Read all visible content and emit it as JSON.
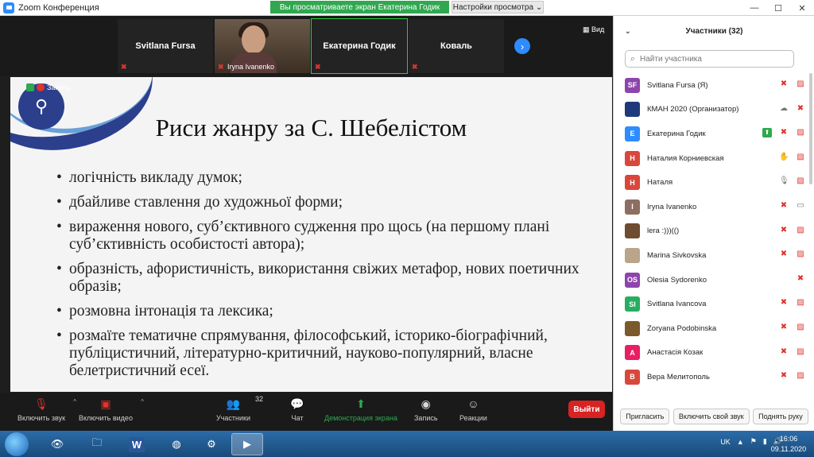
{
  "window": {
    "title": "Zoom Конференция",
    "share_banner": "Вы просматриваете экран Екатерина Годик",
    "view_options": "Настройки просмотра",
    "view_label": "Вид"
  },
  "videos": [
    {
      "name": "Svitlana Fursa"
    },
    {
      "name": "Iryna Ivanenko"
    },
    {
      "name": "Екатерина Годик"
    },
    {
      "name": "Коваль"
    }
  ],
  "slide": {
    "record_label": "Запись",
    "title": "Риси жанру за С. Шебелістом",
    "bullets": [
      "логічність викладу думок;",
      "дбайливе ставлення до художньої форми;",
      "вираження нового, суб’єктивного судження про щось (на першому плані суб’єктивність особистості автора);",
      "образність, афористичність, використання свіжих метафор, нових поетичних образів;",
      "розмовна інтонація та лексика;",
      "розмаїте тематичне спрямування, філософський, історико-біографічний, публіцистичний, літературно-критичний, науково-популярний, власне белетристичний есеї."
    ]
  },
  "toolbar": {
    "mute": "Включить звук",
    "video": "Включить видео",
    "participants": "Участники",
    "participants_count": "32",
    "chat": "Чат",
    "share": "Демонстрация экрана",
    "record": "Запись",
    "reactions": "Реакции",
    "leave": "Выйти"
  },
  "panel": {
    "header": "Участники (32)",
    "search_placeholder": "Найти участника",
    "participants": [
      {
        "initials": "SF",
        "name": "Svitlana Fursa (Я)",
        "color": "#8e44ad",
        "icons": [
          "mic-off",
          "video-off"
        ]
      },
      {
        "initials": "",
        "name": "КМАН 2020 (Организатор)",
        "color": "#1f3a7a",
        "icons": [
          "cloud",
          "mic-off"
        ]
      },
      {
        "initials": "Е",
        "name": "Екатерина Годик",
        "color": "#2d8cff",
        "icons": [
          "share",
          "mic-off",
          "video-off"
        ]
      },
      {
        "initials": "Н",
        "name": "Наталия Корниевская",
        "color": "#d9473b",
        "icons": [
          "hand",
          "video-off"
        ]
      },
      {
        "initials": "Н",
        "name": "Наталя",
        "color": "#d9473b",
        "icons": [
          "mic",
          "video-off"
        ]
      },
      {
        "initials": "I",
        "name": "Iryna Ivanenko",
        "color": "#8d6e63",
        "icons": [
          "mic-off",
          "video"
        ]
      },
      {
        "initials": "",
        "name": "lera :)))(()",
        "color": "#6d4c2f",
        "icons": [
          "mic-off",
          "video-off"
        ]
      },
      {
        "initials": "",
        "name": "Marina Sivkovska",
        "color": "#b9a58a",
        "icons": [
          "mic-off",
          "video-off"
        ]
      },
      {
        "initials": "OS",
        "name": "Olesia Sydorenko",
        "color": "#8e44ad",
        "icons": [
          "mic-off"
        ]
      },
      {
        "initials": "SI",
        "name": "Svitlana Ivancova",
        "color": "#27ae60",
        "icons": [
          "mic-off",
          "video-off"
        ]
      },
      {
        "initials": "",
        "name": "Zoryana Podobinska",
        "color": "#7a5a2a",
        "icons": [
          "mic-off",
          "video-off"
        ]
      },
      {
        "initials": "А",
        "name": "Анастасія Козак",
        "color": "#e91e63",
        "icons": [
          "mic-off",
          "video-off"
        ]
      },
      {
        "initials": "В",
        "name": "Вера Мелитополь",
        "color": "#d9473b",
        "icons": [
          "mic-off",
          "video-off"
        ]
      }
    ],
    "invite": "Пригласить",
    "unmute_self": "Включить свой звук",
    "raise_hand": "Поднять руку"
  },
  "taskbar": {
    "lang": "UK",
    "time": "16:06",
    "date": "09.11.2020"
  }
}
